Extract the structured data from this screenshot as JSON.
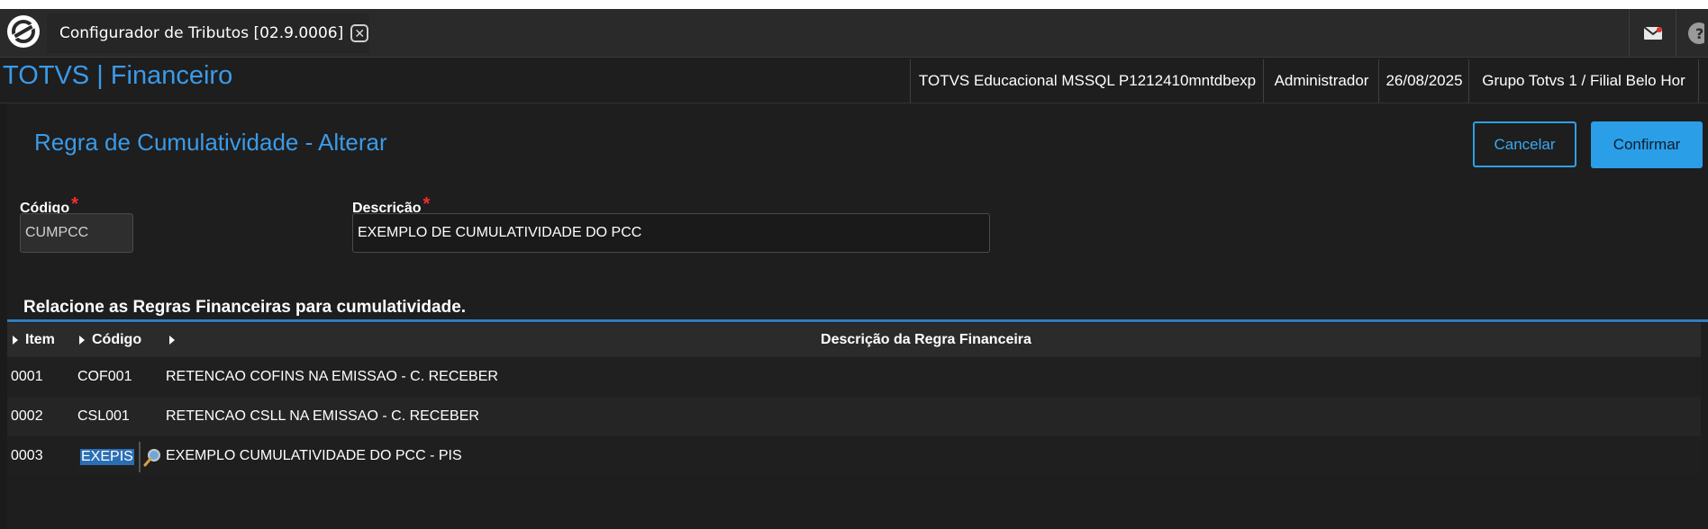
{
  "tabbar": {
    "tab_title": "Configurador de Tributos [02.9.0006]",
    "close_glyph": "✕",
    "icons": [
      "totvs-logo-icon",
      "close-icon",
      "mail-icon",
      "help-icon"
    ]
  },
  "header": {
    "app_title": "TOTVS | Financeiro",
    "environment": "TOTVS Educacional MSSQL P1212410mntdbexp",
    "user": "Administrador",
    "date": "26/08/2025",
    "branch": "Grupo Totvs 1 / Filial Belo Hor"
  },
  "page": {
    "title": "Regra de Cumulatividade - Alterar",
    "cancel_label": "Cancelar",
    "confirm_label": "Confirmar"
  },
  "form": {
    "codigo_label": "Código",
    "codigo_value": "CUMPCC",
    "descricao_label": "Descrição",
    "descricao_value": "EXEMPLO DE CUMULATIVIDADE DO PCC",
    "required_mark": "*"
  },
  "section": {
    "title": "Relacione as Regras Financeiras para cumulatividade."
  },
  "grid": {
    "columns": [
      "Item",
      "Código",
      "Descrição da Regra Financeira"
    ],
    "rows": [
      {
        "item": "0001",
        "codigo": "COF001",
        "descricao": "RETENCAO COFINS NA EMISSAO - C. RECEBER"
      },
      {
        "item": "0002",
        "codigo": "CSL001",
        "descricao": "RETENCAO CSLL NA EMISSAO - C. RECEBER"
      },
      {
        "item": "0003",
        "codigo": "EXEPIS",
        "descricao": "EXEMPLO CUMULATIVIDADE DO PCC - PIS"
      }
    ]
  },
  "colors": {
    "accent": "#3b9ae8",
    "required": "#ff2a2a",
    "background": "#1e1e1e",
    "selection": "#2a6fb5"
  }
}
